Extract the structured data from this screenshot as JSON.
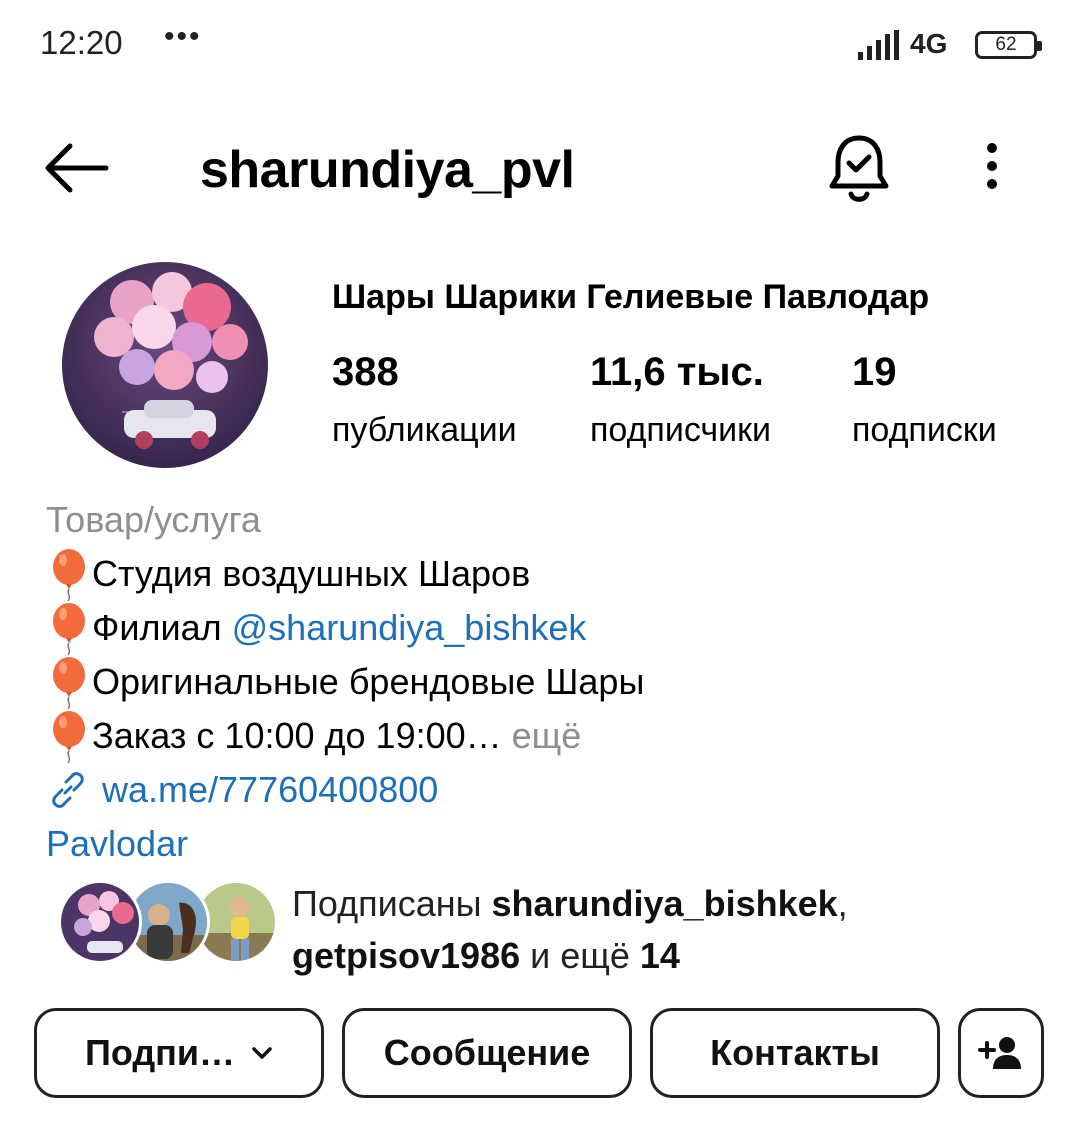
{
  "status_bar": {
    "time": "12:20",
    "dots": "•••",
    "network": "4G",
    "battery": "62"
  },
  "header": {
    "username": "sharundiya_pvl",
    "back_icon": "arrow-left-icon",
    "bell_icon": "bell-check-icon",
    "more_icon": "more-vertical-icon"
  },
  "profile": {
    "display_name": "Шары Шарики Гелиевые Павлодар",
    "stats": {
      "posts_value": "388",
      "posts_label": "публикации",
      "followers_value": "11,6 тыс.",
      "followers_label": "подписчики",
      "following_value": "19",
      "following_label": "подписки"
    }
  },
  "bio": {
    "category": "Товар/услуга",
    "line1": "Студия воздушных Шаров",
    "line2_prefix": "Филиал ",
    "line2_mention": "@sharundiya_bishkek",
    "line3": "Оригинальные брендовые Шары",
    "line4": "Заказ с 10:00 до 19:00",
    "line4_ellipsis": "…",
    "more": " ещё",
    "link": "wa.me/77760400800",
    "location": "Pavlodar"
  },
  "followed_by": {
    "prefix": "Подписаны ",
    "user1": "sharundiya_bishkek",
    "comma": ",",
    "user2": "getpisov1986",
    "middle": " и ещё ",
    "count": "14"
  },
  "actions": {
    "follow": "Подпи…",
    "message": "Сообщение",
    "contacts": "Контакты",
    "add_icon": "add-person-icon"
  },
  "colors": {
    "link_blue": "#1d6fb8",
    "muted_gray": "#8e8e8e",
    "balloon_orange": "#f26b3a"
  }
}
